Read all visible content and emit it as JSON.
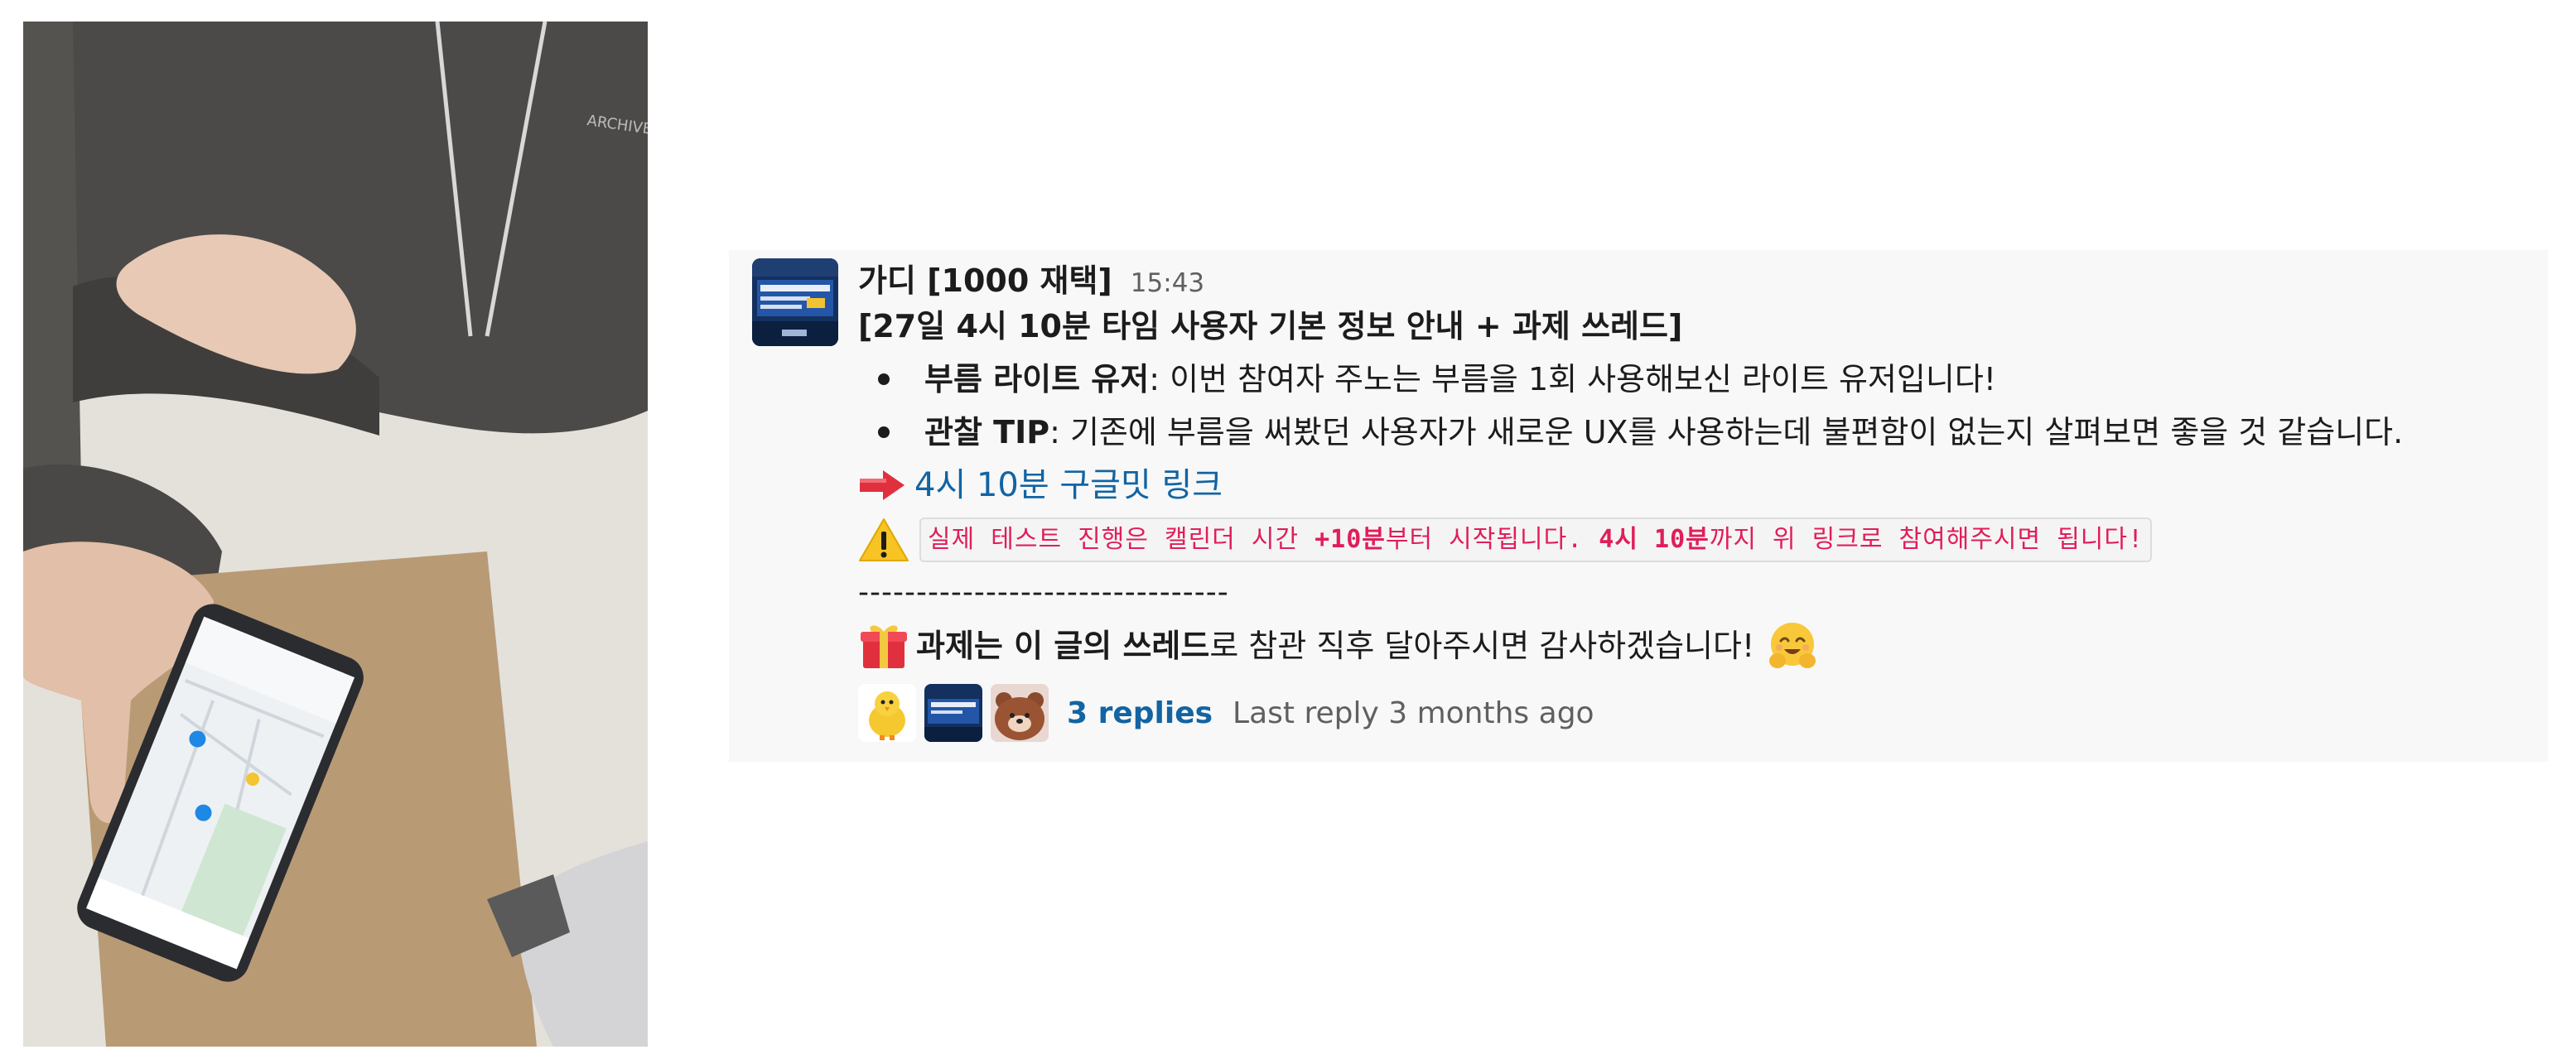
{
  "photo": {
    "alt": "person using a phone map app on a table",
    "hoodie_text": "ARCHIVE GALLERY"
  },
  "message": {
    "sender": "가디 [1000 재택]",
    "time": "15:43",
    "title": "[27일 4시 10분 타임 사용자 기본 정보 안내 + 과제 쓰레드]",
    "bullets": [
      {
        "label": "부름 라이트 유저",
        "text": " : 이번 참여자 주노는 부름을 1회 사용해보신 라이트 유저입니다!"
      },
      {
        "label": "관찰 TIP",
        "text": " : 기존에 부름을 써봤던 사용자가 새로운 UX를 사용하는데 불편함이 없는지 살펴보면 좋을 것 같습니다."
      }
    ],
    "link_text": "4시 10분 구글밋 링크",
    "notice": {
      "part1": "실제 테스트 진행은 캘린더 시간 ",
      "em1": "+10분",
      "part2": "부터 시작됩니다. ",
      "em2": "4시 10분",
      "part3": "까지 위 링크로 참여해주시면 됩니다!"
    },
    "divider": "--------------------------------",
    "task": {
      "bold": "과제는 이 글의 쓰레드",
      "rest": "로 참관 직후 달아주시면 감사하겠습니다!"
    },
    "thread": {
      "replies": "3 replies",
      "last_reply": "Last reply 3 months ago"
    },
    "icons": {
      "arrow": "right-arrow-icon",
      "warning": "warning-icon",
      "gift": "gift-icon",
      "hug": "hugging-face-icon"
    },
    "colors": {
      "link": "#1264a3",
      "code": "#e01e5a",
      "panel_bg": "#f8f8f8"
    }
  }
}
